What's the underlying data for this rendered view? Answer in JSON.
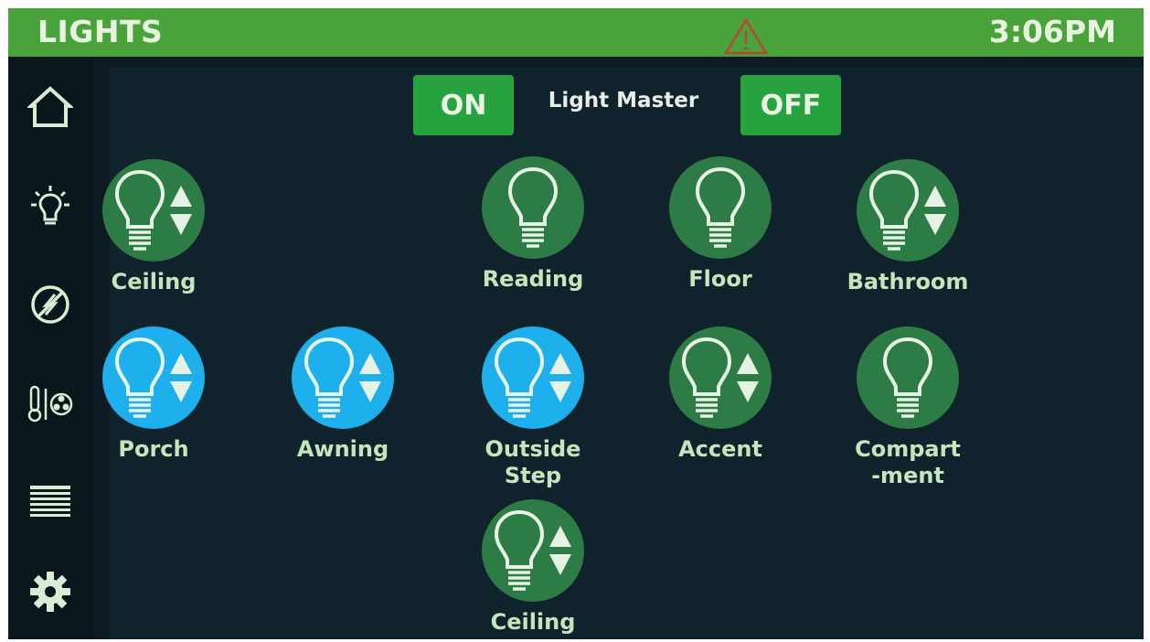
{
  "header": {
    "title": "LIGHTS",
    "time": "3:06PM",
    "warning_icon": "warning-triangle-icon",
    "accent_color": "#4aa33a"
  },
  "sidebar": {
    "items": [
      {
        "icon": "home-icon"
      },
      {
        "icon": "light-bulb-icon"
      },
      {
        "icon": "power-icon"
      },
      {
        "icon": "thermometer-fan-icon"
      },
      {
        "icon": "window-shade-icon"
      },
      {
        "icon": "settings-gear-icon"
      }
    ]
  },
  "master": {
    "on_label": "ON",
    "label": "Light Master",
    "off_label": "OFF"
  },
  "lights": [
    {
      "label": "Ceiling",
      "state": "off",
      "dimmable": true
    },
    {
      "label": "Reading",
      "state": "off",
      "dimmable": false
    },
    {
      "label": "Floor",
      "state": "off",
      "dimmable": false
    },
    {
      "label": "Bathroom",
      "state": "off",
      "dimmable": true
    },
    {
      "label": "Porch",
      "state": "on",
      "dimmable": true
    },
    {
      "label": "Awning",
      "state": "on",
      "dimmable": true
    },
    {
      "label": "Outside\nStep",
      "state": "on",
      "dimmable": true
    },
    {
      "label": "Accent",
      "state": "off",
      "dimmable": true
    },
    {
      "label": "Compart\n-ment",
      "state": "off",
      "dimmable": false
    },
    {
      "label": "Ceiling Accent",
      "state": "off",
      "dimmable": true
    }
  ],
  "colors": {
    "light_off": "#2e7c45",
    "light_on": "#1eb0ec",
    "button": "#27a23f",
    "background": "#10222c"
  }
}
